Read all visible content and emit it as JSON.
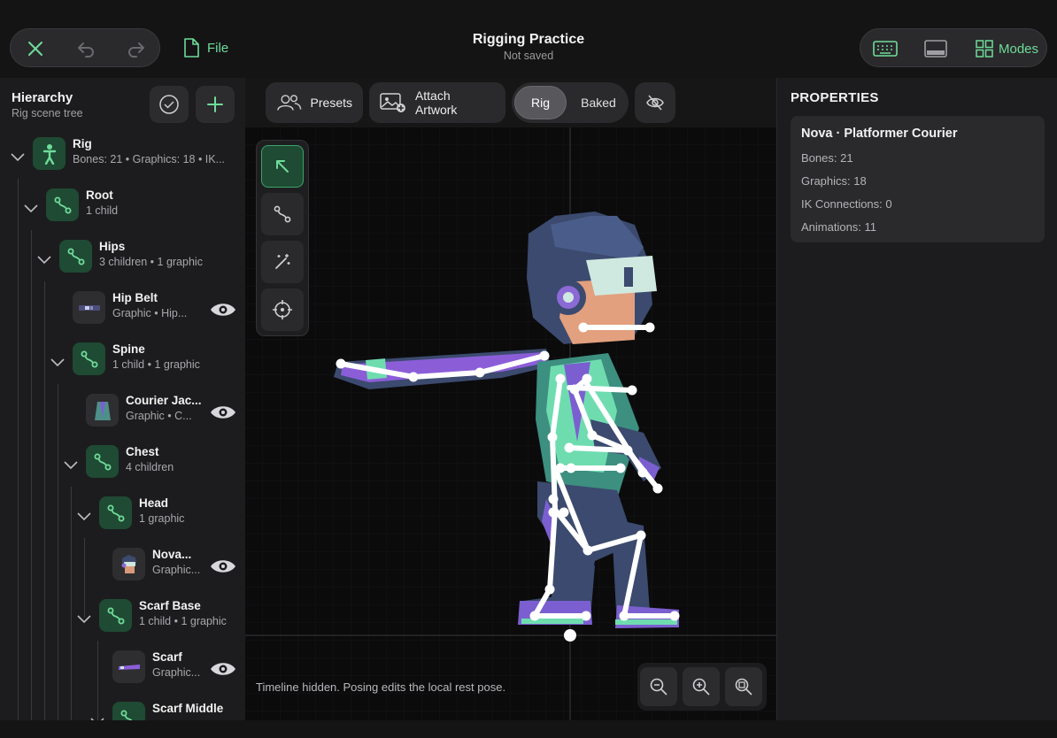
{
  "header": {
    "title": "Rigging Practice",
    "subtitle": "Not saved",
    "file_label": "File",
    "modes_label": "Modes"
  },
  "hierarchy": {
    "title": "Hierarchy",
    "subtitle": "Rig scene tree",
    "nodes": [
      {
        "name": "Rig",
        "meta": "Bones: 21  •  Graphics: 18  •  IK...",
        "type": "rig"
      },
      {
        "name": "Root",
        "meta": "1 child",
        "type": "bone"
      },
      {
        "name": "Hips",
        "meta": "3 children  •  1 graphic",
        "type": "bone"
      },
      {
        "name": "Hip Belt",
        "meta": "Graphic  •  Hip...",
        "type": "graphic"
      },
      {
        "name": "Spine",
        "meta": "1 child  •  1 graphic",
        "type": "bone"
      },
      {
        "name": "Courier Jac...",
        "meta": "Graphic  •  C...",
        "type": "graphic"
      },
      {
        "name": "Chest",
        "meta": "4 children",
        "type": "bone"
      },
      {
        "name": "Head",
        "meta": "1 graphic",
        "type": "bone"
      },
      {
        "name": "Nova...",
        "meta": "Graphic...",
        "type": "graphic"
      },
      {
        "name": "Scarf Base",
        "meta": "1 child  •  1 graphic",
        "type": "bone"
      },
      {
        "name": "Scarf",
        "meta": "Graphic...",
        "type": "graphic"
      },
      {
        "name": "Scarf Middle",
        "meta": "",
        "type": "bone"
      }
    ]
  },
  "toolbar": {
    "presets_label": "Presets",
    "attach_label": "Attach Artwork",
    "rig_label": "Rig",
    "baked_label": "Baked",
    "active_mode": "Rig"
  },
  "canvas": {
    "status": "Timeline hidden. Posing edits the local rest pose."
  },
  "properties": {
    "title": "PROPERTIES",
    "card_title": "Nova · Platformer Courier",
    "rows": [
      "Bones: 21",
      "Graphics: 18",
      "IK Connections: 0",
      "Animations: 11"
    ]
  },
  "colors": {
    "accent": "#6fdc9a",
    "bone_bg": "#1f4a33",
    "panel": "#1c1c1e"
  }
}
